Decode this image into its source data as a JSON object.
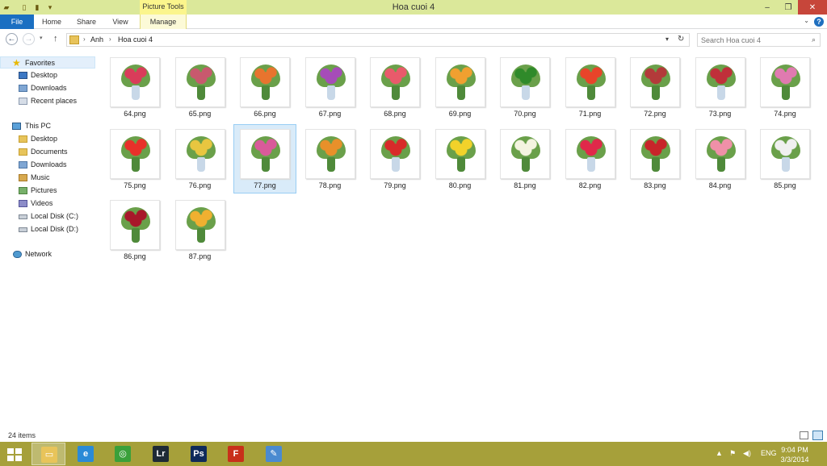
{
  "window": {
    "title": "Hoa cuoi 4",
    "picture_tools_label": "Picture Tools",
    "minimize_glyph": "–",
    "restore_glyph": "❐",
    "close_glyph": "✕"
  },
  "ribbon": {
    "tabs": [
      {
        "label": "File"
      },
      {
        "label": "Home"
      },
      {
        "label": "Share"
      },
      {
        "label": "View"
      },
      {
        "label": "Manage"
      }
    ],
    "help_glyph": "?",
    "expand_glyph": "⌄"
  },
  "address": {
    "crumbs": [
      "Anh",
      "Hoa cuoi 4"
    ],
    "search_placeholder": "Search Hoa cuoi 4"
  },
  "nav": {
    "favorites": {
      "label": "Favorites",
      "items": [
        "Desktop",
        "Downloads",
        "Recent places"
      ]
    },
    "thispc": {
      "label": "This PC",
      "items": [
        "Desktop",
        "Documents",
        "Downloads",
        "Music",
        "Pictures",
        "Videos",
        "Local Disk (C:)",
        "Local Disk (D:)"
      ]
    },
    "network": {
      "label": "Network"
    }
  },
  "files": [
    {
      "name": "64.png"
    },
    {
      "name": "65.png"
    },
    {
      "name": "66.png"
    },
    {
      "name": "67.png"
    },
    {
      "name": "68.png"
    },
    {
      "name": "69.png"
    },
    {
      "name": "70.png"
    },
    {
      "name": "71.png"
    },
    {
      "name": "72.png"
    },
    {
      "name": "73.png"
    },
    {
      "name": "74.png"
    },
    {
      "name": "75.png"
    },
    {
      "name": "76.png"
    },
    {
      "name": "77.png"
    },
    {
      "name": "78.png"
    },
    {
      "name": "79.png"
    },
    {
      "name": "80.png"
    },
    {
      "name": "81.png"
    },
    {
      "name": "82.png"
    },
    {
      "name": "83.png"
    },
    {
      "name": "84.png"
    },
    {
      "name": "85.png"
    },
    {
      "name": "86.png"
    },
    {
      "name": "87.png"
    }
  ],
  "selected_file": "77.png",
  "thumbnail_colors": [
    "#d93c5a",
    "#c8596e",
    "#e8742e",
    "#a64cb8",
    "#e95a6b",
    "#f0a030",
    "#2f8a2a",
    "#e8442a",
    "#b33a3a",
    "#c0303a",
    "#e07ab0",
    "#e8302a",
    "#e8c640",
    "#d95a9a",
    "#e8902a",
    "#d82a2a",
    "#f2d22a",
    "#f4f4e0",
    "#e0284a",
    "#c8242a",
    "#f090a8",
    "#f0f0f0",
    "#a8182a",
    "#f0b030"
  ],
  "status": {
    "item_count": "24 items"
  },
  "taskbar": {
    "apps": [
      {
        "name": "file-explorer",
        "glyph": "▭",
        "color": "#e8c45a",
        "active": true
      },
      {
        "name": "internet-explorer",
        "glyph": "e",
        "color": "#2a8ad6",
        "active": false
      },
      {
        "name": "browser-green",
        "glyph": "◎",
        "color": "#3aa03a",
        "active": false
      },
      {
        "name": "lightroom",
        "glyph": "Lr",
        "color": "#1e2a36",
        "active": false
      },
      {
        "name": "photoshop",
        "glyph": "Ps",
        "color": "#0f2a5a",
        "active": false
      },
      {
        "name": "flash",
        "glyph": "F",
        "color": "#c8301a",
        "active": false
      },
      {
        "name": "paint",
        "glyph": "✎",
        "color": "#4a8ad0",
        "active": false
      }
    ],
    "tray": {
      "language": "ENG",
      "time": "9:04 PM",
      "date": "3/3/2014"
    }
  }
}
